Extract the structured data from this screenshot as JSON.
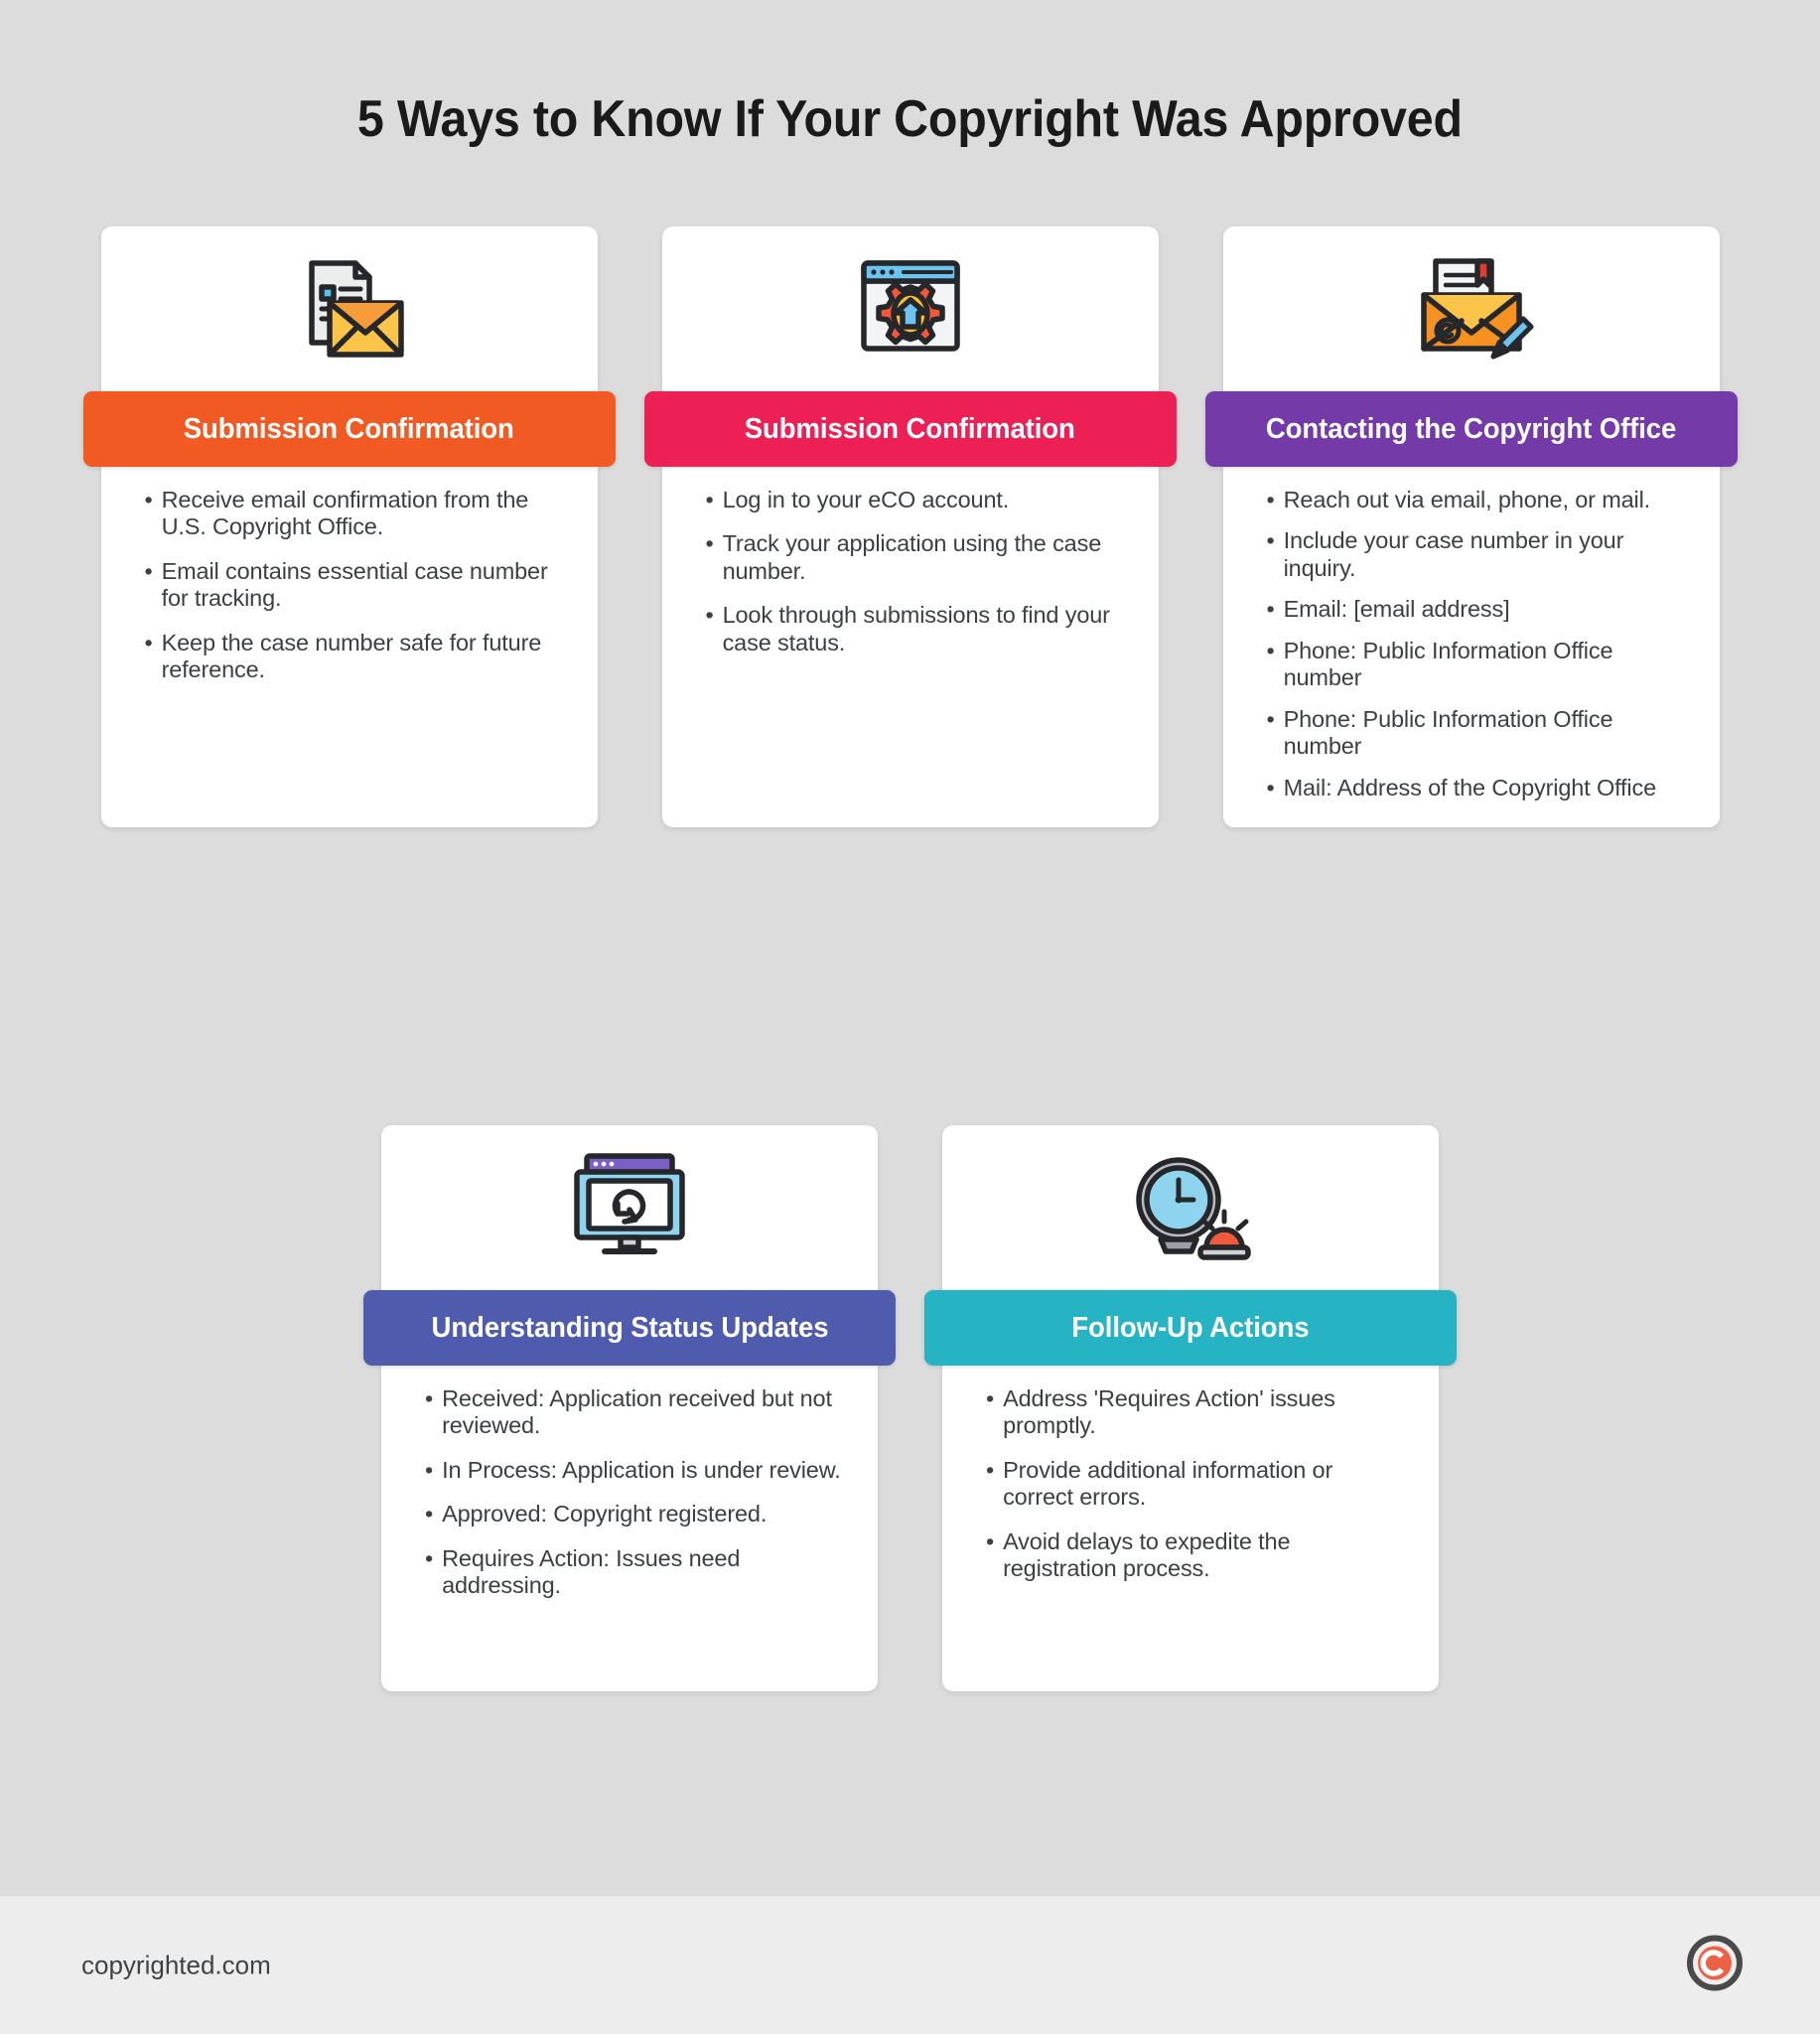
{
  "page": {
    "title": "5 Ways to Know If Your Copyright Was Approved",
    "background_color": "#dcdcdc",
    "card_background": "#ffffff",
    "body_text_color": "#3b4043"
  },
  "cards": [
    {
      "id": "submission-confirmation-email",
      "header": "Submission Confirmation",
      "header_color": "#F15A22",
      "icon": "email-document-icon",
      "bullets": [
        "Receive email confirmation from the U.S. Copyright Office.",
        "Email contains essential case number for tracking.",
        "Keep the case number safe for future reference."
      ]
    },
    {
      "id": "submission-confirmation-eco",
      "header": "Submission Confirmation",
      "header_color": "#EC2055",
      "icon": "browser-gear-upload-icon",
      "bullets": [
        "Log in to your eCO account.",
        "Track your application using the case number.",
        "Look through submissions to find your case status."
      ]
    },
    {
      "id": "contacting-the-copyright-office",
      "header": "Contacting the Copyright Office",
      "header_color": "#733AA8",
      "icon": "envelope-copyright-pencil-icon",
      "bullets": [
        "Reach out via email, phone, or mail.",
        "Include your case number in your inquiry.",
        "Email: [email address]",
        "Phone: Public Information Office number",
        "Phone: Public Information Office number",
        "Mail: Address of the Copyright Office"
      ]
    },
    {
      "id": "understanding-status-updates",
      "header": "Understanding Status Updates",
      "header_color": "#4F5BAD",
      "icon": "monitor-refresh-icon",
      "bullets": [
        "Received: Application received but not reviewed.",
        "In Process: Application is under review.",
        "Approved: Copyright registered.",
        "Requires Action: Issues need addressing."
      ]
    },
    {
      "id": "follow-up-actions",
      "header": "Follow-Up Actions",
      "header_color": "#26B3C3",
      "icon": "clock-alarm-icon",
      "bullets": [
        "Address 'Requires Action' issues promptly.",
        "Provide additional information or correct errors.",
        "Avoid delays to expedite the registration process."
      ]
    }
  ],
  "bullet_marker": "•",
  "footer": {
    "site": "copyrighted.com",
    "logo": "copyright-c-logo",
    "logo_ring_color": "#4a4a4a",
    "logo_inner_color": "#EC6144"
  }
}
